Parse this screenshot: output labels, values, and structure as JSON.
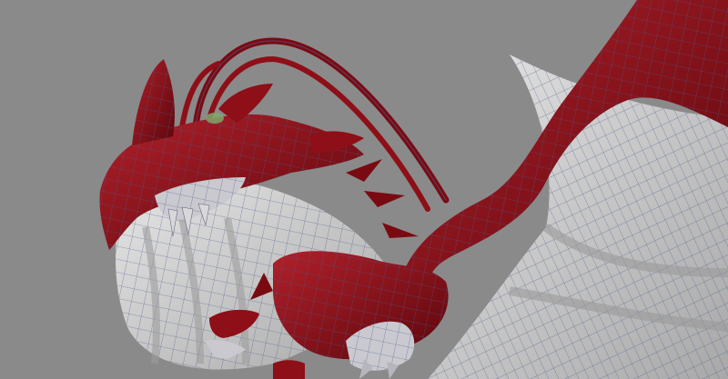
{
  "scene": {
    "subject": "dragon-wireframe-model",
    "colors": {
      "background": "#8a8a8a",
      "body_red": "#8e0f17",
      "body_red_dark": "#5c060c",
      "body_red_light": "#b0202a",
      "wing_membrane": "#d9d9d9",
      "wing_shadow": "#a6a6a6",
      "wire": "#4c5a8c",
      "claw": "#c9c9cf",
      "accent_green": "#7fa86a"
    }
  }
}
